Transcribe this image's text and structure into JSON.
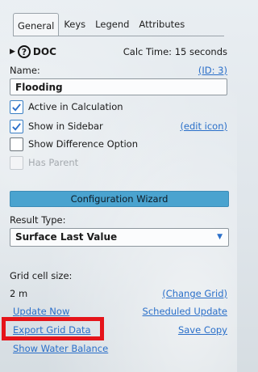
{
  "tabs": [
    {
      "label": "General",
      "active": true
    },
    {
      "label": "Keys",
      "active": false
    },
    {
      "label": "Legend",
      "active": false
    },
    {
      "label": "Attributes",
      "active": false
    }
  ],
  "doc": {
    "label": "DOC",
    "calc_time": "Calc Time: 15 seconds"
  },
  "name": {
    "label": "Name:",
    "id_link": "(ID: 3)",
    "value": "Flooding"
  },
  "options": [
    {
      "label": "Active in Calculation",
      "checked": true,
      "enabled": true
    },
    {
      "label": "Show in Sidebar",
      "checked": true,
      "enabled": true,
      "link": "(edit icon)"
    },
    {
      "label": "Show Difference Option",
      "checked": false,
      "enabled": true
    },
    {
      "label": "Has Parent",
      "checked": false,
      "enabled": false
    }
  ],
  "wizard_button": "Configuration Wizard",
  "result_type": {
    "label": "Result Type:",
    "value": "Surface Last Value"
  },
  "grid": {
    "label": "Grid cell size:",
    "value": "2 m",
    "change_link": "(Change Grid)"
  },
  "actions": {
    "update_now": "Update Now",
    "scheduled_update": "Scheduled Update",
    "export_grid_data": "Export Grid Data",
    "save_copy": "Save Copy",
    "show_water_balance": "Show Water Balance"
  },
  "colors": {
    "accent": "#2a6fc9",
    "button": "#4aa3cf",
    "highlight": "#e5141a"
  }
}
